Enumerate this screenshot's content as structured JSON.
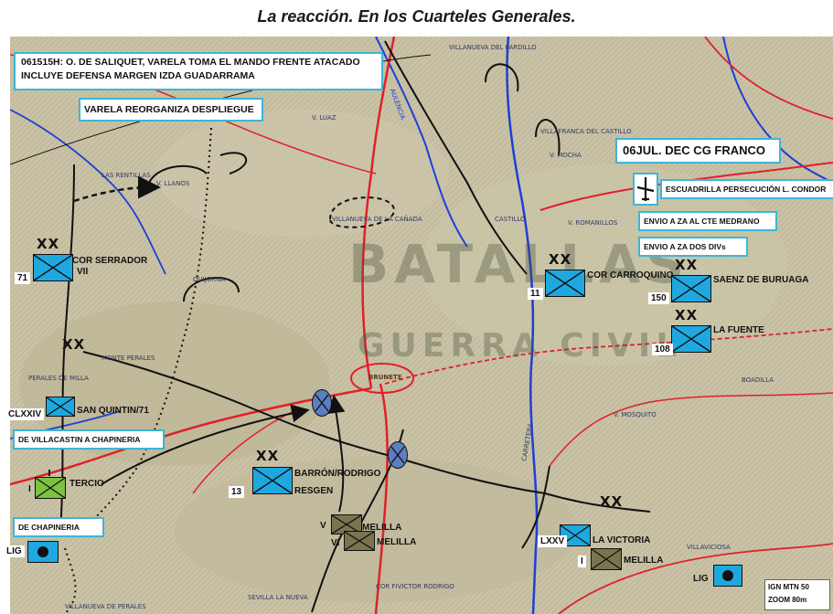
{
  "title": "La reacción. En los Cuarteles Generales.",
  "colors": {
    "friendly": "#1fa8e0",
    "reserve": "#7bc142",
    "enemy": "#7a7550",
    "brigade": "#5b7fc0",
    "road": "#e0202a",
    "river": "#1e3fd8",
    "box_border": "#3fb4d6"
  },
  "callouts": {
    "saliquet_line1": "061515H: O. DE SALIQUET, VARELA TOMA EL MANDO FRENTE ATACADO",
    "saliquet_line2": "INCLUYE DEFENSA MARGEN  IZDA GUADARRAMA",
    "varela": "VARELA REORGANIZA DESPLIEGUE",
    "franco": "06JUL. DEC CG FRANCO",
    "condor": "ESCUADRILLA PERSECUCIÓN L. CONDOR",
    "medrano": "ENVIO A ZA AL CTE MEDRANO",
    "dos_divs": "ENVIO A ZA  DOS DIVs",
    "villacastin": "DE VILLACASTIN A CHAPINERIA",
    "chapineria": "DE  CHAPINERIA",
    "source_line1": "IGN MTN 50",
    "source_line2": "ZOOM 80m"
  },
  "units": {
    "serrador": {
      "number": "71",
      "roman": "VII",
      "name": "COR SERRADOR",
      "echelon": "XX"
    },
    "san_quintin": {
      "number": "CLXXIV",
      "name": "SAN QUINTIN/71"
    },
    "tercio": {
      "name": "TERCIO",
      "roman": "I"
    },
    "lig_west": {
      "name": "LIG"
    },
    "barron": {
      "number": "13",
      "name1": "BARRÓN/RODRIGO",
      "name2": "RESGEN",
      "echelon": "XX"
    },
    "carroquino": {
      "number": "11",
      "name": "COR CARROQUINO",
      "echelon": "XX"
    },
    "saenz": {
      "number": "150",
      "name": "SAENZ DE BURUAGA",
      "echelon": "XX"
    },
    "la_fuente": {
      "number": "108",
      "name": "LA FUENTE",
      "echelon": "XX"
    },
    "melilla_v": {
      "roman": "V",
      "name": "MELILLA"
    },
    "melilla_vi": {
      "roman": "VI",
      "name": "MELILLA"
    },
    "la_victoria": {
      "number": "LXXV",
      "name": "LA VICTORIA"
    },
    "melilla_i": {
      "roman": "I",
      "name": "MELILLA"
    },
    "lig_east": {
      "name": "LIG"
    }
  },
  "boundary_marks": {
    "west": "XX",
    "south": "XX"
  },
  "places": {
    "brunete": "BRUNETE",
    "villanueva_canada": "VILLANUEVA DE LA CAÑADA",
    "villanueva_pardillo": "VILLANUEVA DEL PARDILLO",
    "villafranca": "VILLAFRANCA DEL CASTILLO",
    "quijorna": "QUIJORNA",
    "rentillas": "LAS RENTILLAS",
    "llanos": "V. LLANOS",
    "luaz": "V. LUAZ",
    "romanillos": "V. ROMANILLOS",
    "mocha": "V. MOCHA",
    "castillo": "CASTILLO",
    "monte_perales": "MONTE PERALES",
    "perales_milla": "PERALES DE MILLA",
    "mosquito": "V. MOSQUITO",
    "boadilla": "BOADILLA",
    "villaviciosa": "VILLAVICIOSA",
    "carretera": "CARRETERA",
    "sevilla_nueva": "SEVILLA LA NUEVA",
    "villanueva_perales": "VILLANUEVA DE PERALES",
    "aulencia": "AULENCIA",
    "cor_elvictor": "COR FIVICTOR RODRIGO"
  },
  "watermark": {
    "line1": "BATALLAS",
    "line2": "GUERRA CIVIL"
  }
}
